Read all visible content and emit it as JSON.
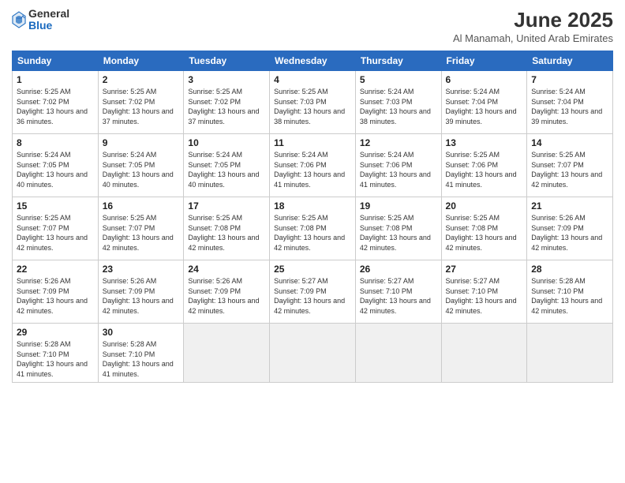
{
  "header": {
    "logo_general": "General",
    "logo_blue": "Blue",
    "month_year": "June 2025",
    "location": "Al Manamah, United Arab Emirates"
  },
  "weekdays": [
    "Sunday",
    "Monday",
    "Tuesday",
    "Wednesday",
    "Thursday",
    "Friday",
    "Saturday"
  ],
  "weeks": [
    [
      {
        "day": "1",
        "sunrise": "5:25 AM",
        "sunset": "7:02 PM",
        "daylight": "13 hours and 36 minutes."
      },
      {
        "day": "2",
        "sunrise": "5:25 AM",
        "sunset": "7:02 PM",
        "daylight": "13 hours and 37 minutes."
      },
      {
        "day": "3",
        "sunrise": "5:25 AM",
        "sunset": "7:02 PM",
        "daylight": "13 hours and 37 minutes."
      },
      {
        "day": "4",
        "sunrise": "5:25 AM",
        "sunset": "7:03 PM",
        "daylight": "13 hours and 38 minutes."
      },
      {
        "day": "5",
        "sunrise": "5:24 AM",
        "sunset": "7:03 PM",
        "daylight": "13 hours and 38 minutes."
      },
      {
        "day": "6",
        "sunrise": "5:24 AM",
        "sunset": "7:04 PM",
        "daylight": "13 hours and 39 minutes."
      },
      {
        "day": "7",
        "sunrise": "5:24 AM",
        "sunset": "7:04 PM",
        "daylight": "13 hours and 39 minutes."
      }
    ],
    [
      {
        "day": "8",
        "sunrise": "5:24 AM",
        "sunset": "7:05 PM",
        "daylight": "13 hours and 40 minutes."
      },
      {
        "day": "9",
        "sunrise": "5:24 AM",
        "sunset": "7:05 PM",
        "daylight": "13 hours and 40 minutes."
      },
      {
        "day": "10",
        "sunrise": "5:24 AM",
        "sunset": "7:05 PM",
        "daylight": "13 hours and 40 minutes."
      },
      {
        "day": "11",
        "sunrise": "5:24 AM",
        "sunset": "7:06 PM",
        "daylight": "13 hours and 41 minutes."
      },
      {
        "day": "12",
        "sunrise": "5:24 AM",
        "sunset": "7:06 PM",
        "daylight": "13 hours and 41 minutes."
      },
      {
        "day": "13",
        "sunrise": "5:25 AM",
        "sunset": "7:06 PM",
        "daylight": "13 hours and 41 minutes."
      },
      {
        "day": "14",
        "sunrise": "5:25 AM",
        "sunset": "7:07 PM",
        "daylight": "13 hours and 42 minutes."
      }
    ],
    [
      {
        "day": "15",
        "sunrise": "5:25 AM",
        "sunset": "7:07 PM",
        "daylight": "13 hours and 42 minutes."
      },
      {
        "day": "16",
        "sunrise": "5:25 AM",
        "sunset": "7:07 PM",
        "daylight": "13 hours and 42 minutes."
      },
      {
        "day": "17",
        "sunrise": "5:25 AM",
        "sunset": "7:08 PM",
        "daylight": "13 hours and 42 minutes."
      },
      {
        "day": "18",
        "sunrise": "5:25 AM",
        "sunset": "7:08 PM",
        "daylight": "13 hours and 42 minutes."
      },
      {
        "day": "19",
        "sunrise": "5:25 AM",
        "sunset": "7:08 PM",
        "daylight": "13 hours and 42 minutes."
      },
      {
        "day": "20",
        "sunrise": "5:25 AM",
        "sunset": "7:08 PM",
        "daylight": "13 hours and 42 minutes."
      },
      {
        "day": "21",
        "sunrise": "5:26 AM",
        "sunset": "7:09 PM",
        "daylight": "13 hours and 42 minutes."
      }
    ],
    [
      {
        "day": "22",
        "sunrise": "5:26 AM",
        "sunset": "7:09 PM",
        "daylight": "13 hours and 42 minutes."
      },
      {
        "day": "23",
        "sunrise": "5:26 AM",
        "sunset": "7:09 PM",
        "daylight": "13 hours and 42 minutes."
      },
      {
        "day": "24",
        "sunrise": "5:26 AM",
        "sunset": "7:09 PM",
        "daylight": "13 hours and 42 minutes."
      },
      {
        "day": "25",
        "sunrise": "5:27 AM",
        "sunset": "7:09 PM",
        "daylight": "13 hours and 42 minutes."
      },
      {
        "day": "26",
        "sunrise": "5:27 AM",
        "sunset": "7:10 PM",
        "daylight": "13 hours and 42 minutes."
      },
      {
        "day": "27",
        "sunrise": "5:27 AM",
        "sunset": "7:10 PM",
        "daylight": "13 hours and 42 minutes."
      },
      {
        "day": "28",
        "sunrise": "5:28 AM",
        "sunset": "7:10 PM",
        "daylight": "13 hours and 42 minutes."
      }
    ],
    [
      {
        "day": "29",
        "sunrise": "5:28 AM",
        "sunset": "7:10 PM",
        "daylight": "13 hours and 41 minutes."
      },
      {
        "day": "30",
        "sunrise": "5:28 AM",
        "sunset": "7:10 PM",
        "daylight": "13 hours and 41 minutes."
      },
      {
        "day": "",
        "sunrise": "",
        "sunset": "",
        "daylight": ""
      },
      {
        "day": "",
        "sunrise": "",
        "sunset": "",
        "daylight": ""
      },
      {
        "day": "",
        "sunrise": "",
        "sunset": "",
        "daylight": ""
      },
      {
        "day": "",
        "sunrise": "",
        "sunset": "",
        "daylight": ""
      },
      {
        "day": "",
        "sunrise": "",
        "sunset": "",
        "daylight": ""
      }
    ]
  ]
}
